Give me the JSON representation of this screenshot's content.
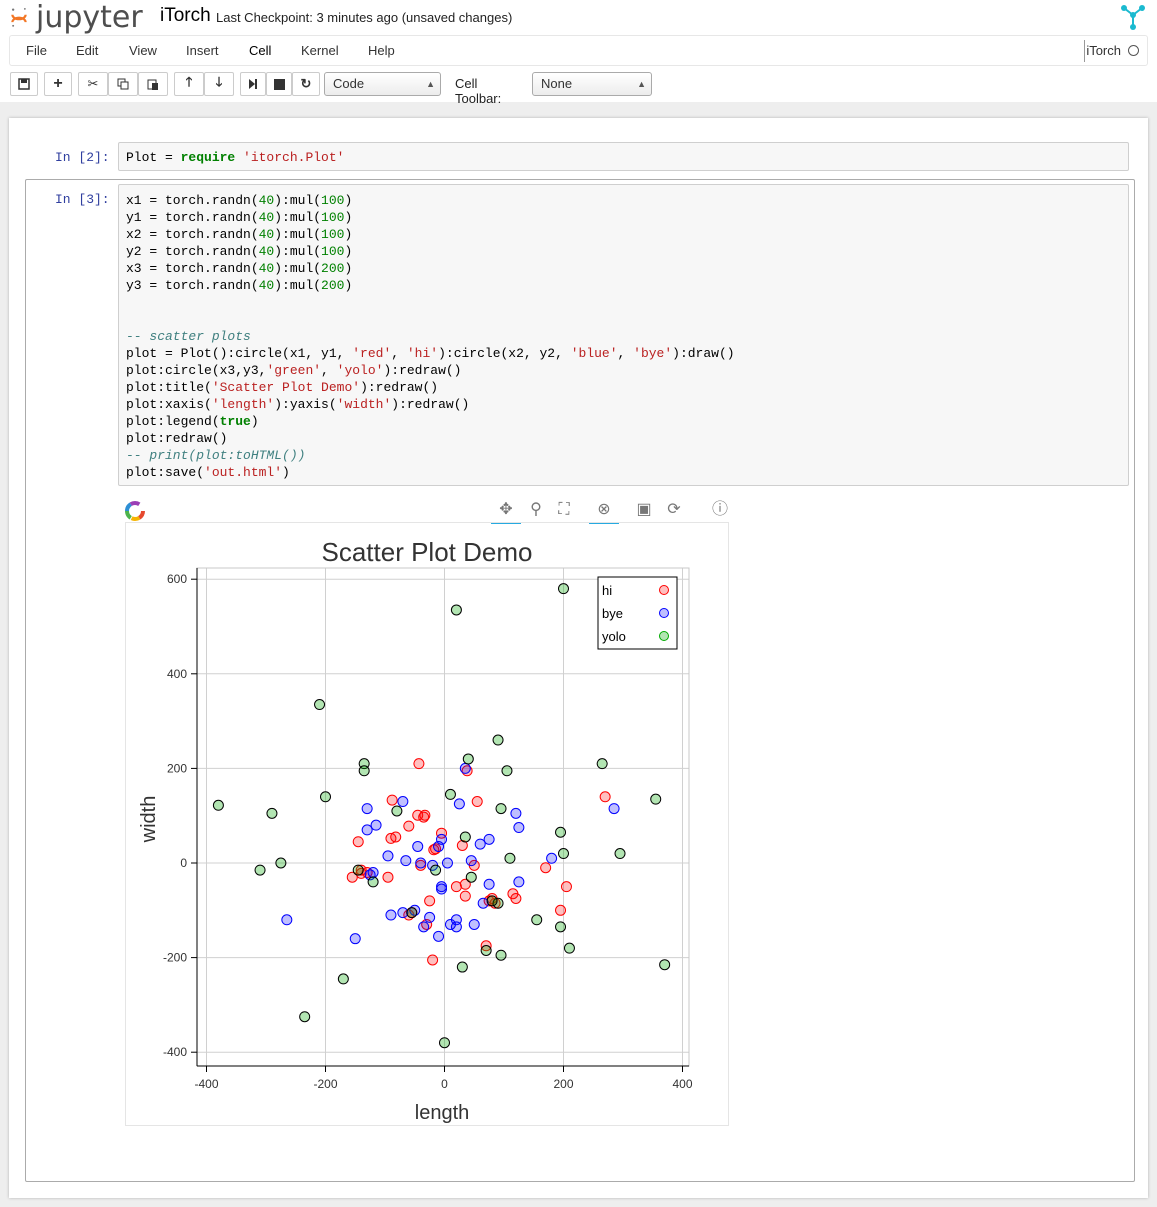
{
  "header": {
    "logo_text": "jupyter",
    "notebook_title": "iTorch",
    "checkpoint": "Last Checkpoint: 3 minutes ago (unsaved changes)"
  },
  "menu": {
    "items": [
      "File",
      "Edit",
      "View",
      "Insert",
      "Cell",
      "Kernel",
      "Help"
    ],
    "kernel_name": "iTorch"
  },
  "toolbar": {
    "buttons": [
      "save-icon",
      "plus-icon",
      "cut-icon",
      "copy-icon",
      "paste-icon",
      "arrow-up-icon",
      "arrow-down-icon",
      "step-forward-icon",
      "stop-icon",
      "refresh-icon"
    ],
    "cell_type": "Code",
    "cell_toolbar_label": "Cell Toolbar:",
    "cell_toolbar_value": "None"
  },
  "cells": [
    {
      "prompt": "In [2]:",
      "lines": [
        "Plot = require 'itorch.Plot'"
      ]
    },
    {
      "prompt": "In [3]:",
      "lines": [
        "x1 = torch.randn(40):mul(100)",
        "y1 = torch.randn(40):mul(100)",
        "x2 = torch.randn(40):mul(100)",
        "y2 = torch.randn(40):mul(100)",
        "x3 = torch.randn(40):mul(200)",
        "y3 = torch.randn(40):mul(200)",
        "",
        "",
        "-- scatter plots",
        "plot = Plot():circle(x1, y1, 'red', 'hi'):circle(x2, y2, 'blue', 'bye'):draw()",
        "plot:circle(x3,y3,'green', 'yolo'):redraw()",
        "plot:title('Scatter Plot Demo'):redraw()",
        "plot:xaxis('length'):yaxis('width'):redraw()",
        "plot:legend(true)",
        "plot:redraw()",
        "-- print(plot:toHTML())",
        "plot:save('out.html')"
      ]
    }
  ],
  "bokeh_tools": [
    "pan-icon",
    "wheel-zoom-icon",
    "box-zoom-icon",
    "resize-icon",
    "save-icon",
    "reset-icon",
    "help-icon"
  ],
  "chart_data": {
    "type": "scatter",
    "title": "Scatter Plot Demo",
    "xlabel": "length",
    "ylabel": "width",
    "xlim": [
      -400,
      400
    ],
    "ylim": [
      -400,
      600
    ],
    "xticks": [
      -400,
      -200,
      0,
      200,
      400
    ],
    "yticks": [
      -400,
      -200,
      0,
      200,
      400,
      600
    ],
    "grid": true,
    "legend": "top-right",
    "colors": {
      "hi": "#ff0000",
      "bye": "#0000ff",
      "yolo": "#00aa00"
    },
    "series": [
      {
        "name": "hi",
        "points": [
          [
            -43,
            210
          ],
          [
            38,
            195
          ],
          [
            -88,
            133
          ],
          [
            -60,
            78
          ],
          [
            -45,
            101
          ],
          [
            -33,
            101
          ],
          [
            -90,
            52
          ],
          [
            -145,
            45
          ],
          [
            -35,
            97
          ],
          [
            -5,
            63
          ],
          [
            -15,
            30
          ],
          [
            -18,
            28
          ],
          [
            30,
            37
          ],
          [
            50,
            -5
          ],
          [
            -155,
            -30
          ],
          [
            -140,
            -15
          ],
          [
            -130,
            -20
          ],
          [
            -95,
            -30
          ],
          [
            -60,
            -110
          ],
          [
            -25,
            -80
          ],
          [
            20,
            -50
          ],
          [
            35,
            -45
          ],
          [
            35,
            -70
          ],
          [
            80,
            -75
          ],
          [
            85,
            -85
          ],
          [
            115,
            -65
          ],
          [
            120,
            -75
          ],
          [
            170,
            -10
          ],
          [
            195,
            -100
          ],
          [
            205,
            -50
          ],
          [
            270,
            140
          ],
          [
            -20,
            -205
          ],
          [
            70,
            -175
          ],
          [
            -55,
            -105
          ],
          [
            -30,
            -130
          ],
          [
            -82,
            55
          ],
          [
            55,
            130
          ],
          [
            -140,
            -22
          ],
          [
            75,
            -80
          ],
          [
            -40,
            -5
          ]
        ]
      },
      {
        "name": "bye",
        "points": [
          [
            -130,
            115
          ],
          [
            -70,
            130
          ],
          [
            -130,
            70
          ],
          [
            -115,
            80
          ],
          [
            -95,
            15
          ],
          [
            -65,
            5
          ],
          [
            -45,
            35
          ],
          [
            -10,
            35
          ],
          [
            -5,
            50
          ],
          [
            5,
            0
          ],
          [
            -40,
            0
          ],
          [
            -20,
            -5
          ],
          [
            -5,
            -55
          ],
          [
            -50,
            -100
          ],
          [
            -70,
            -105
          ],
          [
            -90,
            -110
          ],
          [
            -120,
            -20
          ],
          [
            -125,
            -25
          ],
          [
            -25,
            -115
          ],
          [
            -35,
            -135
          ],
          [
            -10,
            -155
          ],
          [
            10,
            -130
          ],
          [
            20,
            -120
          ],
          [
            20,
            -135
          ],
          [
            50,
            -130
          ],
          [
            65,
            -85
          ],
          [
            75,
            -45
          ],
          [
            45,
            5
          ],
          [
            60,
            40
          ],
          [
            75,
            50
          ],
          [
            120,
            105
          ],
          [
            125,
            75
          ],
          [
            125,
            -40
          ],
          [
            180,
            10
          ],
          [
            285,
            115
          ],
          [
            -265,
            -120
          ],
          [
            -150,
            -160
          ],
          [
            25,
            125
          ],
          [
            35,
            200
          ],
          [
            -5,
            -50
          ]
        ]
      },
      {
        "name": "yolo",
        "points": [
          [
            -380,
            122
          ],
          [
            -290,
            105
          ],
          [
            -310,
            -15
          ],
          [
            -275,
            0
          ],
          [
            -210,
            335
          ],
          [
            -200,
            140
          ],
          [
            -135,
            210
          ],
          [
            -135,
            195
          ],
          [
            -120,
            -40
          ],
          [
            -145,
            -15
          ],
          [
            -80,
            110
          ],
          [
            -55,
            -105
          ],
          [
            -15,
            -15
          ],
          [
            10,
            145
          ],
          [
            20,
            535
          ],
          [
            35,
            55
          ],
          [
            40,
            220
          ],
          [
            45,
            -30
          ],
          [
            90,
            260
          ],
          [
            95,
            115
          ],
          [
            105,
            195
          ],
          [
            110,
            10
          ],
          [
            90,
            -85
          ],
          [
            80,
            -80
          ],
          [
            70,
            -185
          ],
          [
            95,
            -195
          ],
          [
            30,
            -220
          ],
          [
            0,
            -380
          ],
          [
            -170,
            -245
          ],
          [
            -235,
            -325
          ],
          [
            155,
            -120
          ],
          [
            195,
            65
          ],
          [
            200,
            20
          ],
          [
            195,
            -135
          ],
          [
            210,
            -180
          ],
          [
            200,
            580
          ],
          [
            265,
            210
          ],
          [
            295,
            20
          ],
          [
            355,
            135
          ],
          [
            370,
            -215
          ]
        ]
      }
    ]
  }
}
